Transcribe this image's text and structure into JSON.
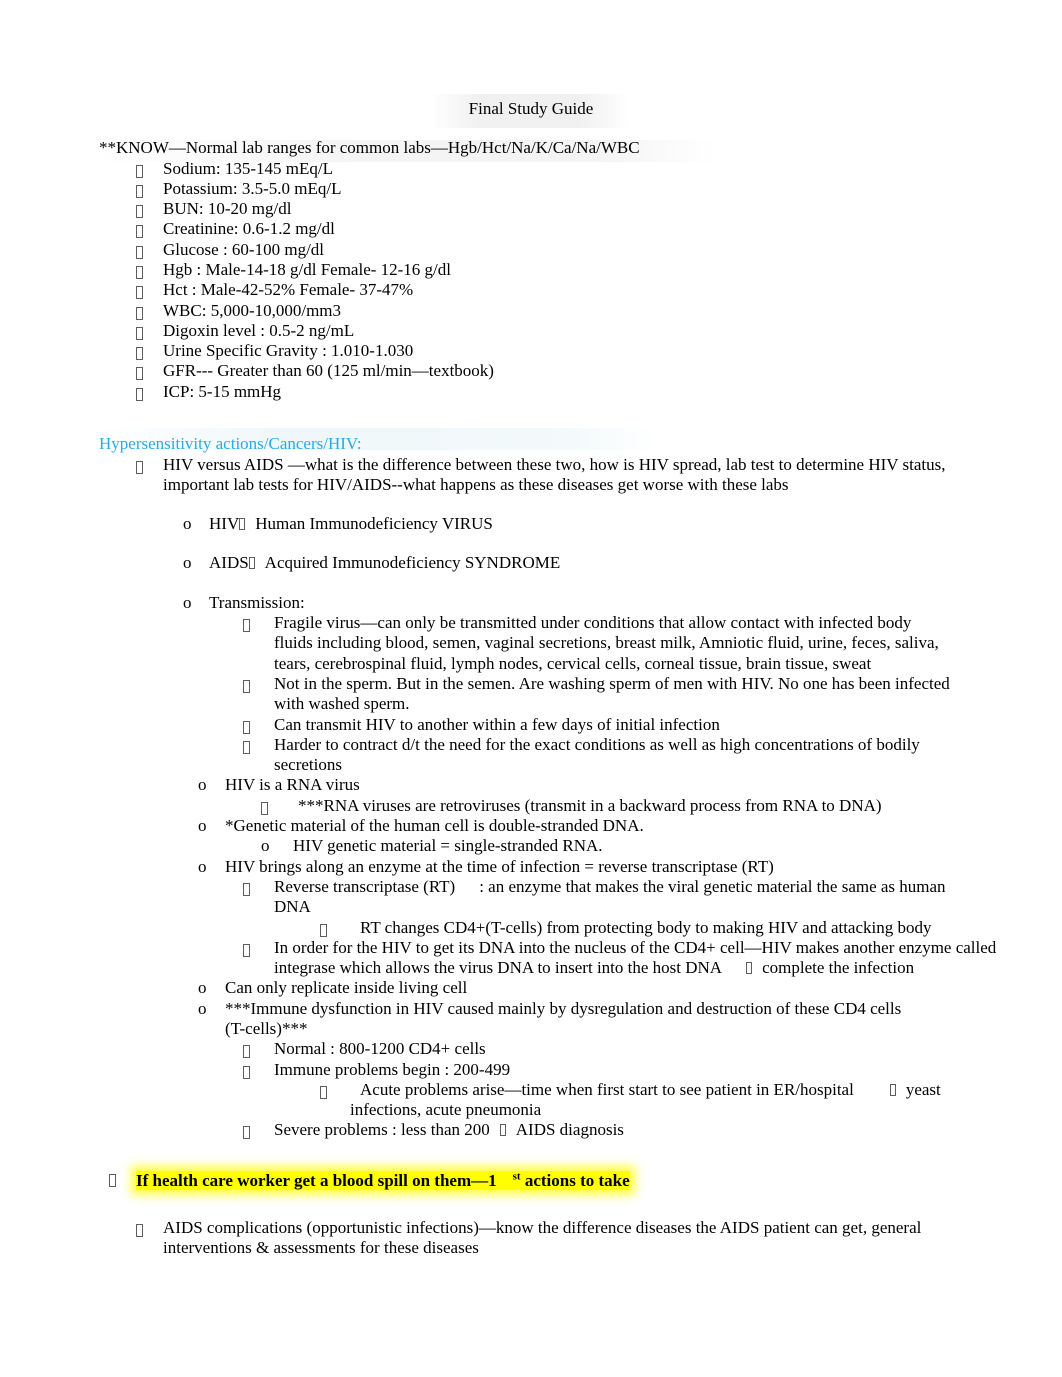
{
  "document": {
    "title": "Final Study Guide",
    "intro_line": "**KNOW—Normal lab ranges for common labs—Hgb/Hct/Na/K/Ca/Na/WBC"
  },
  "lab_values": [
    "Sodium:   135-145 mEq/L",
    "Potassium:    3.5-5.0 mEq/L",
    "BUN: 10-20 mg/dl",
    "Creatinine:    0.6-1.2 mg/dl",
    "Glucose : 60-100 mg/dl",
    "Hgb :  Male-14-18 g/dl     Female- 12-16 g/dl",
    "Hct :  Male-42-52%     Female- 37-47%",
    "WBC: 5,000-10,000/mm3",
    "Digoxin level  :  0.5-2 ng/mL",
    "Urine Specific Gravity    : 1.010-1.030",
    "GFR--- Greater than 60 (125 ml/min—textbook)",
    "ICP: 5-15 mmHg"
  ],
  "hiv_section": {
    "heading": "Hypersensitivity actions/Cancers/HIV:",
    "main_bullet": "HIV versus AIDS —what is the difference between these two, how is HIV spread, lab test to determine HIV status, important lab tests for HIV/AIDS--what happens as these diseases get worse with these labs",
    "hiv_acronym_pre": "HIV",
    "hiv_acronym_post": "Human Immunodeficiency   VIRUS",
    "aids_acronym_pre": "AIDS",
    "aids_acronym_post": "Acquired Immunodeficiency   SYNDROME",
    "transmission_label": "Transmission:",
    "transmission_items": [
      "Fragile virus—can only be transmitted under conditions that allow contact with infected body fluids including blood, semen, vaginal secretions, breast milk, Amniotic fluid, urine, feces, saliva, tears, cerebrospinal fluid, lymph nodes, cervical cells, corneal tissue, brain tissue, sweat",
      "Not in the sperm.   But in the semen.   Are washing sperm of men with HIV. No one has been infected with washed sperm.",
      "Can transmit HIV to another within a few days of initial infection",
      "Harder to contract d/t the need for the exact conditions as well as high concentrations of bodily secretions"
    ],
    "rna_virus": "HIV is a RNA virus",
    "rna_retro": "***RNA viruses are retroviruses (transmit in a backward process from RNA to DNA)",
    "genetic_material_human": "*Genetic material of the human cell is double-stranded DNA.",
    "genetic_material_hiv": "HIV genetic material = single-stranded RNA.",
    "enzyme_rt": "HIV brings along an enzyme at the time of infection = reverse transcriptase (RT)",
    "rt_definition_pre": "Reverse transcriptase (RT)",
    "rt_definition_post": ": an enzyme that makes the viral genetic material the same as human DNA",
    "rt_changes": "RT changes CD4+(T-cells) from protecting body to making HIV and attacking body",
    "integrase_pre": "In order for the HIV to get its DNA into the nucleus of the CD4+ cell—HIV makes another enzyme called integrase which allows the virus DNA to insert into the host DNA",
    "integrase_post": "complete the infection",
    "replicate": "Can only replicate inside living cell",
    "immune_dysfunction": "***Immune dysfunction in HIV caused mainly by dysregulation and destruction of these CD4 cells (T-cells)***",
    "cd4_normal": "Normal : 800-1200 CD4+ cells",
    "cd4_immune_problems": "Immune problems begin      : 200-499",
    "cd4_acute_pre": "Acute problems arise—time when first start to see patient in ER/hospital",
    "cd4_acute_post": "yeast infections, acute pneumonia",
    "cd4_severe_pre": "Severe problems    : less than 200",
    "cd4_severe_post": "AIDS diagnosis",
    "blood_spill_pre": "If health care worker get a blood spill on them—1",
    "blood_spill_sup": "st",
    "blood_spill_post": "actions to take",
    "aids_complications": "AIDS complications    (opportunistic infections)—know the difference diseases the AIDS patient can get, general interventions & assessments for these diseases"
  },
  "colors": {
    "heading_blue": "#29ABE2",
    "highlight_yellow": "#ffff00",
    "text_black": "#000000"
  }
}
